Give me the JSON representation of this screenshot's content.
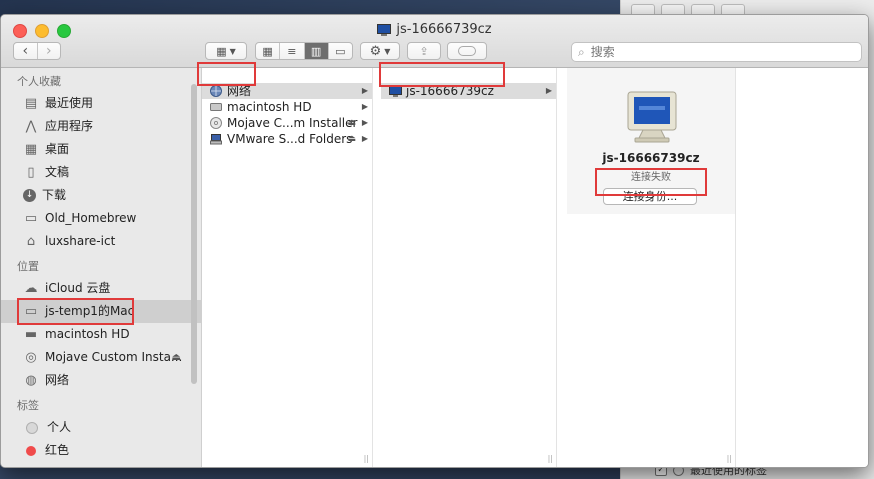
{
  "window": {
    "title": "js-16666739cz"
  },
  "search": {
    "placeholder": "搜索"
  },
  "sidebar": {
    "favorites_header": "个人收藏",
    "favorites": [
      {
        "label": "最近使用",
        "icon": "recents-icon"
      },
      {
        "label": "应用程序",
        "icon": "applications-icon"
      },
      {
        "label": "桌面",
        "icon": "desktop-icon"
      },
      {
        "label": "文稿",
        "icon": "documents-icon"
      },
      {
        "label": "下载",
        "icon": "downloads-icon"
      },
      {
        "label": "Old_Homebrew",
        "icon": "folder-icon"
      },
      {
        "label": "luxshare-ict",
        "icon": "home-icon"
      }
    ],
    "locations_header": "位置",
    "locations": [
      {
        "label": "iCloud 云盘",
        "icon": "icloud-icon"
      },
      {
        "label": "js-temp1的Mac",
        "icon": "computer-icon",
        "selected": true
      },
      {
        "label": "macintosh HD",
        "icon": "disk-icon"
      },
      {
        "label": "Mojave Custom Insta...",
        "icon": "optical-disk-icon",
        "eject": true
      },
      {
        "label": "网络",
        "icon": "network-icon"
      }
    ],
    "tags_header": "标签",
    "tags": [
      {
        "label": "个人",
        "color": "#d8d8d8"
      },
      {
        "label": "红色",
        "color": "#f04b4b"
      }
    ]
  },
  "column1": {
    "items": [
      {
        "label": "网络",
        "icon": "network-icon",
        "selected": true
      },
      {
        "label": "macintosh HD",
        "icon": "disk-icon"
      },
      {
        "label": "Mojave C...m Installer",
        "icon": "optical-disk-icon"
      },
      {
        "label": "VMware S...d Folders",
        "icon": "server-icon"
      }
    ]
  },
  "column2": {
    "items": [
      {
        "label": "js-16666739cz",
        "icon": "monitor-icon",
        "selected": true
      }
    ]
  },
  "preview": {
    "name": "js-16666739cz",
    "status": "连接失败",
    "connect_label": "连接身份..."
  },
  "background_window": {
    "footer_label": "最近使用的标签"
  },
  "colors": {
    "highlight": "#e03a3a",
    "selection": "#cfcfcf"
  }
}
